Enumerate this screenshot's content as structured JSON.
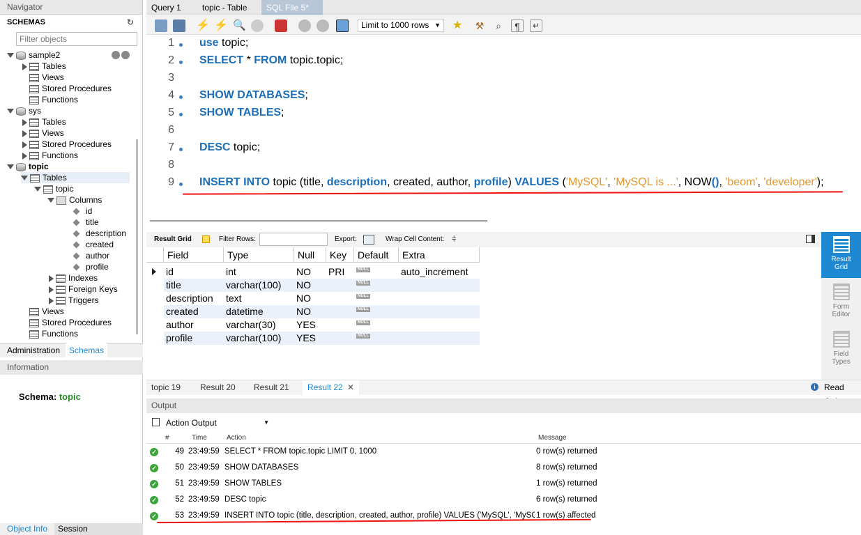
{
  "navigator": {
    "title": "Navigator",
    "schemas_label": "SCHEMAS",
    "filter_placeholder": "Filter objects",
    "tree": [
      {
        "label": "sample2",
        "level": 0,
        "kind": "db",
        "expanded": true
      },
      {
        "label": "Tables",
        "level": 1,
        "kind": "folder",
        "expanded": false
      },
      {
        "label": "Views",
        "level": 1,
        "kind": "folder",
        "expanded": null
      },
      {
        "label": "Stored Procedures",
        "level": 1,
        "kind": "folder",
        "expanded": null
      },
      {
        "label": "Functions",
        "level": 1,
        "kind": "folder",
        "expanded": null
      },
      {
        "label": "sys",
        "level": 0,
        "kind": "db",
        "expanded": true
      },
      {
        "label": "Tables",
        "level": 1,
        "kind": "folder",
        "expanded": false
      },
      {
        "label": "Views",
        "level": 1,
        "kind": "folder",
        "expanded": false
      },
      {
        "label": "Stored Procedures",
        "level": 1,
        "kind": "folder",
        "expanded": false
      },
      {
        "label": "Functions",
        "level": 1,
        "kind": "folder",
        "expanded": false
      },
      {
        "label": "topic",
        "level": 0,
        "kind": "db",
        "expanded": true,
        "bold": true
      },
      {
        "label": "Tables",
        "level": 1,
        "kind": "folder",
        "expanded": true
      },
      {
        "label": "topic",
        "level": 2,
        "kind": "table",
        "expanded": true
      },
      {
        "label": "Columns",
        "level": 3,
        "kind": "cols",
        "expanded": true
      },
      {
        "label": "id",
        "level": 4,
        "kind": "col"
      },
      {
        "label": "title",
        "level": 4,
        "kind": "col"
      },
      {
        "label": "description",
        "level": 4,
        "kind": "col"
      },
      {
        "label": "created",
        "level": 4,
        "kind": "col"
      },
      {
        "label": "author",
        "level": 4,
        "kind": "col"
      },
      {
        "label": "profile",
        "level": 4,
        "kind": "col"
      },
      {
        "label": "Indexes",
        "level": 3,
        "kind": "folder",
        "expanded": false
      },
      {
        "label": "Foreign Keys",
        "level": 3,
        "kind": "folder",
        "expanded": false
      },
      {
        "label": "Triggers",
        "level": 3,
        "kind": "folder",
        "expanded": false
      },
      {
        "label": "Views",
        "level": 1,
        "kind": "folder",
        "expanded": null
      },
      {
        "label": "Stored Procedures",
        "level": 1,
        "kind": "folder",
        "expanded": null
      },
      {
        "label": "Functions",
        "level": 1,
        "kind": "folder",
        "expanded": null
      }
    ],
    "tab_admin": "Administration",
    "tab_schemas": "Schemas",
    "info_title": "Information",
    "schema_label": "Schema:",
    "schema_value": "topic",
    "tab_object_info": "Object Info",
    "tab_session": "Session"
  },
  "tabs": [
    "Query 1",
    "topic - Table",
    "SQL File 5*"
  ],
  "toolbar": {
    "limit_label": "Limit to 1000 rows"
  },
  "editor": {
    "lines": [
      {
        "n": "1",
        "dot": true,
        "parts": [
          [
            "kw",
            "use"
          ],
          [
            "t",
            " topic;"
          ]
        ]
      },
      {
        "n": "2",
        "dot": true,
        "parts": [
          [
            "kw",
            "SELECT"
          ],
          [
            "t",
            " * "
          ],
          [
            "kw",
            "FROM"
          ],
          [
            "t",
            " topic.topic;"
          ]
        ]
      },
      {
        "n": "3",
        "dot": false,
        "parts": []
      },
      {
        "n": "4",
        "dot": true,
        "parts": [
          [
            "kw",
            "SHOW DATABASES"
          ],
          [
            "t",
            ";"
          ]
        ]
      },
      {
        "n": "5",
        "dot": true,
        "parts": [
          [
            "kw",
            "SHOW TABLES"
          ],
          [
            "t",
            ";"
          ]
        ]
      },
      {
        "n": "6",
        "dot": false,
        "parts": []
      },
      {
        "n": "7",
        "dot": true,
        "parts": [
          [
            "kw",
            "DESC"
          ],
          [
            "t",
            " topic;"
          ]
        ]
      },
      {
        "n": "8",
        "dot": false,
        "parts": []
      },
      {
        "n": "9",
        "dot": true,
        "parts": [
          [
            "kw",
            "INSERT INTO"
          ],
          [
            "t",
            " topic (title, "
          ],
          [
            "kw",
            "description"
          ],
          [
            "t",
            ", created, author, "
          ],
          [
            "kw",
            "profile"
          ],
          [
            "t",
            ") "
          ],
          [
            "kw",
            "VALUES"
          ],
          [
            "t",
            " ("
          ],
          [
            "str",
            "'MySQL'"
          ],
          [
            "t",
            ", "
          ],
          [
            "str",
            "'MySQL is ...'"
          ],
          [
            "t",
            ", "
          ],
          [
            "t",
            "NOW"
          ],
          [
            "kw",
            "()"
          ],
          [
            "t",
            ", "
          ],
          [
            "str",
            "'beom'"
          ],
          [
            "t",
            ", "
          ],
          [
            "str",
            "'developer'"
          ],
          [
            "t",
            ");"
          ]
        ]
      }
    ]
  },
  "result_bar": {
    "result_grid": "Result Grid",
    "filter_rows": "Filter Rows:",
    "export": "Export:",
    "wrap": "Wrap Cell Content:"
  },
  "grid": {
    "headers": [
      "Field",
      "Type",
      "Null",
      "Key",
      "Default",
      "Extra"
    ],
    "rows": [
      [
        "id",
        "int",
        "NO",
        "PRI",
        "NULL",
        "auto_increment"
      ],
      [
        "title",
        "varchar(100)",
        "NO",
        "",
        "NULL",
        ""
      ],
      [
        "description",
        "text",
        "NO",
        "",
        "NULL",
        ""
      ],
      [
        "created",
        "datetime",
        "NO",
        "",
        "NULL",
        ""
      ],
      [
        "author",
        "varchar(30)",
        "YES",
        "",
        "NULL",
        ""
      ],
      [
        "profile",
        "varchar(100)",
        "YES",
        "",
        "NULL",
        ""
      ]
    ]
  },
  "side_panel": [
    {
      "label": "Result\nGrid",
      "active": true
    },
    {
      "label": "Form\nEditor",
      "active": false
    },
    {
      "label": "Field\nTypes",
      "active": false
    }
  ],
  "result_tabs": [
    "topic 19",
    "Result 20",
    "Result 21",
    "Result 22"
  ],
  "read_only": "Read Only",
  "output": {
    "title": "Output",
    "selector": "Action Output",
    "headers": [
      "#",
      "Time",
      "Action",
      "Message"
    ],
    "rows": [
      [
        "49",
        "23:49:59",
        "SELECT * FROM topic.topic LIMIT 0, 1000",
        "0 row(s) returned"
      ],
      [
        "50",
        "23:49:59",
        "SHOW DATABASES",
        "8 row(s) returned"
      ],
      [
        "51",
        "23:49:59",
        "SHOW TABLES",
        "1 row(s) returned"
      ],
      [
        "52",
        "23:49:59",
        "DESC topic",
        "6 row(s) returned"
      ],
      [
        "53",
        "23:49:59",
        "INSERT INTO topic (title, description, created, author, profile) VALUES ('MySQL', 'MySQL i...",
        "1 row(s) affected"
      ]
    ]
  },
  "colors": {
    "keyword": "#1c6fb8",
    "string": "#e0982c",
    "accent": "#1e88d2",
    "underline": "#e11111"
  }
}
